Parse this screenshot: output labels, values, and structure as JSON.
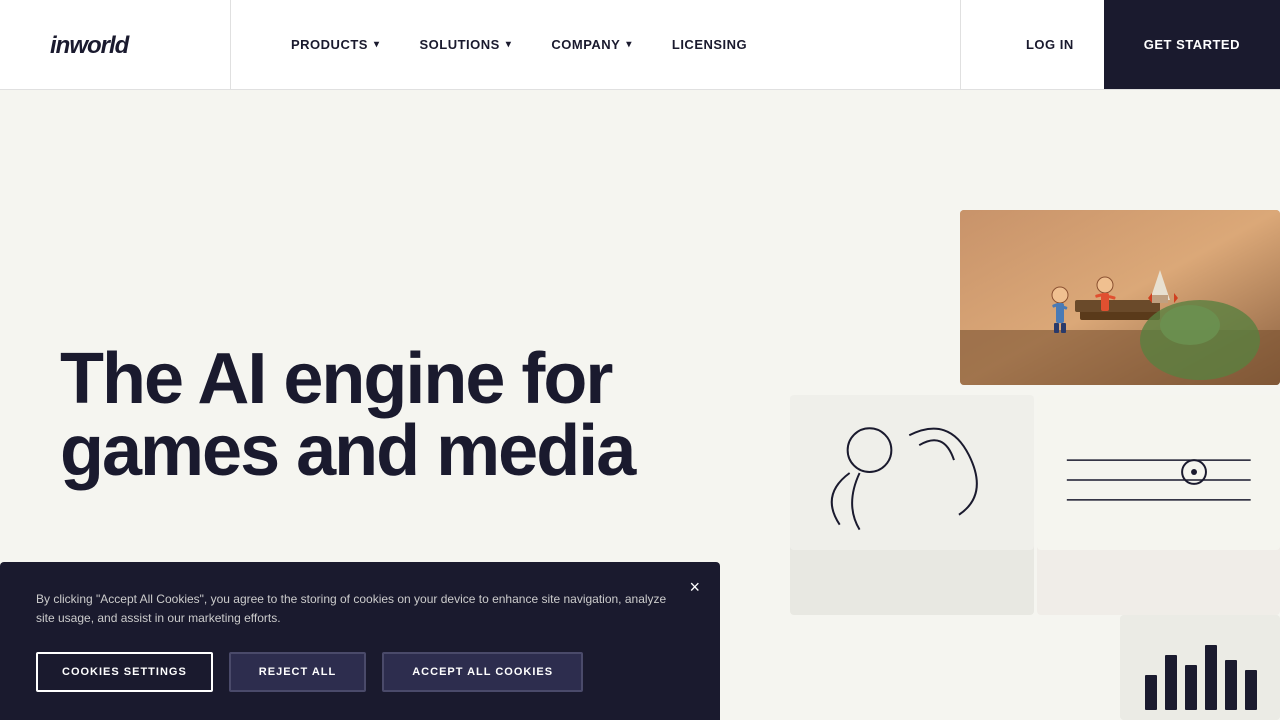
{
  "navbar": {
    "logo": "inworld",
    "nav_items": [
      {
        "label": "PRODUCTS",
        "has_dropdown": true
      },
      {
        "label": "SOLUTIONS",
        "has_dropdown": true
      },
      {
        "label": "COMPANY",
        "has_dropdown": true
      },
      {
        "label": "LICENSING",
        "has_dropdown": false
      }
    ],
    "login_label": "LOG IN",
    "get_started_label": "GET STARTED"
  },
  "hero": {
    "heading_line1": "The AI engine for",
    "heading_line2": "games and media"
  },
  "cookie_banner": {
    "description": "By clicking \"Accept All Cookies\", you agree to the storing of cookies on your device to enhance site navigation, analyze site usage, and assist in our marketing efforts.",
    "cookies_settings_label": "COOKIES SETTINGS",
    "reject_all_label": "REJECT ALL",
    "accept_all_label": "ACCEPT ALL COOKIES",
    "close_icon": "×"
  },
  "colors": {
    "bg": "#f5f5f0",
    "navbar_bg": "#ffffff",
    "dark": "#1a1a2e",
    "cookie_bg": "#1a1a2e"
  }
}
